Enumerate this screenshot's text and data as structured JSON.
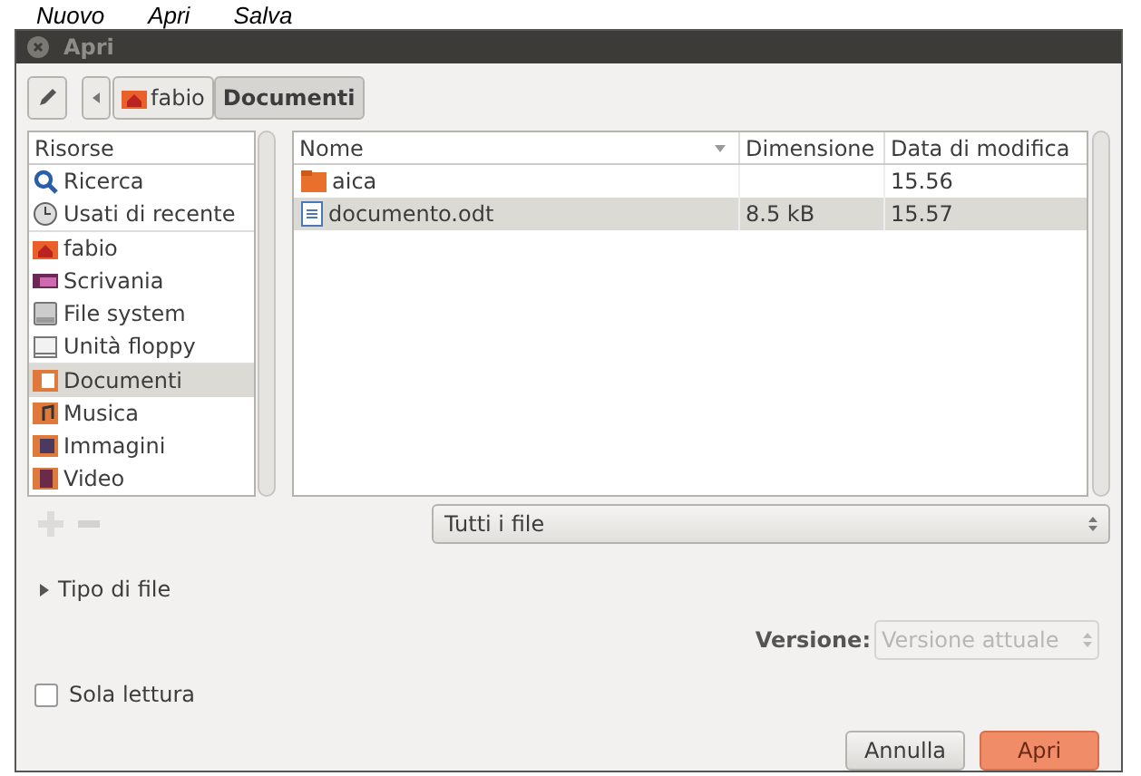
{
  "background_toolbar": [
    "Nuovo",
    "Apri",
    "Salva"
  ],
  "window": {
    "title": "Apri"
  },
  "path_bar": [
    {
      "label": "fabio",
      "kind": "home",
      "selected": false
    },
    {
      "label": "Documenti",
      "kind": "plain",
      "selected": true
    }
  ],
  "sidebar": {
    "header": "Risorse",
    "groups": [
      [
        {
          "label": "Ricerca",
          "kind": "search",
          "selected": false
        },
        {
          "label": "Usati di recente",
          "kind": "recent",
          "selected": false
        }
      ],
      [
        {
          "label": "fabio",
          "kind": "home",
          "selected": false
        },
        {
          "label": "Scrivania",
          "kind": "desktop",
          "selected": false
        },
        {
          "label": "File system",
          "kind": "drive",
          "selected": false
        },
        {
          "label": "Unità floppy",
          "kind": "floppy",
          "selected": false
        }
      ],
      [
        {
          "label": "Documenti",
          "kind": "documents",
          "selected": true
        },
        {
          "label": "Musica",
          "kind": "music",
          "selected": false
        },
        {
          "label": "Immagini",
          "kind": "pictures",
          "selected": false
        },
        {
          "label": "Video",
          "kind": "video",
          "selected": false
        }
      ]
    ]
  },
  "table": {
    "columns": [
      "Nome",
      "Dimensione",
      "Data di modifica"
    ],
    "rows": [
      {
        "kind": "folder",
        "name": "aica",
        "size": "",
        "modified": "15.56",
        "selected": false
      },
      {
        "kind": "document",
        "name": "documento.odt",
        "size": "8.5 kB",
        "modified": "15.57",
        "selected": true
      }
    ]
  },
  "filter": {
    "value": "Tutti i file"
  },
  "file_type_expander": {
    "label": "Tipo di file",
    "expanded": false
  },
  "version": {
    "label": "Versione:",
    "value": "Versione attuale",
    "disabled": true
  },
  "read_only": {
    "label": "Sola lettura",
    "checked": false
  },
  "buttons": [
    {
      "label": "Annulla",
      "kind": "secondary"
    },
    {
      "label": "Apri",
      "kind": "primary"
    }
  ]
}
